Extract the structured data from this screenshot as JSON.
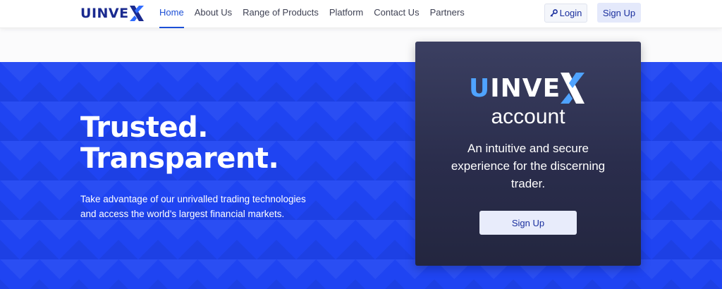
{
  "brand": {
    "logo_letter_u": "U",
    "logo_rest": "INVE"
  },
  "nav": {
    "items": [
      {
        "label": "Home",
        "active": true
      },
      {
        "label": "About Us"
      },
      {
        "label": "Range of Products"
      },
      {
        "label": "Platform"
      },
      {
        "label": "Contact Us"
      },
      {
        "label": "Partners"
      }
    ],
    "login_label": "Login",
    "signup_label": "Sign Up"
  },
  "hero": {
    "title_line1": "Trusted.",
    "title_line2": "Transparent.",
    "description": "Take advantage of our unrivalled trading technologies and access the world's largest financial markets."
  },
  "card": {
    "logo_letter_u": "U",
    "logo_rest": "INVE",
    "subtitle": "account",
    "description": "An intuitive and secure experience for the discerning trader.",
    "button_label": "Sign Up"
  },
  "colors": {
    "brand_blue": "#1f44f2",
    "nav_active": "#1c4fd6",
    "card_bg": "#2e3150",
    "logo_accent": "#4fa3ff"
  },
  "icons": {
    "login_icon": "key-icon",
    "logo_mark": "x-mark-icon"
  }
}
